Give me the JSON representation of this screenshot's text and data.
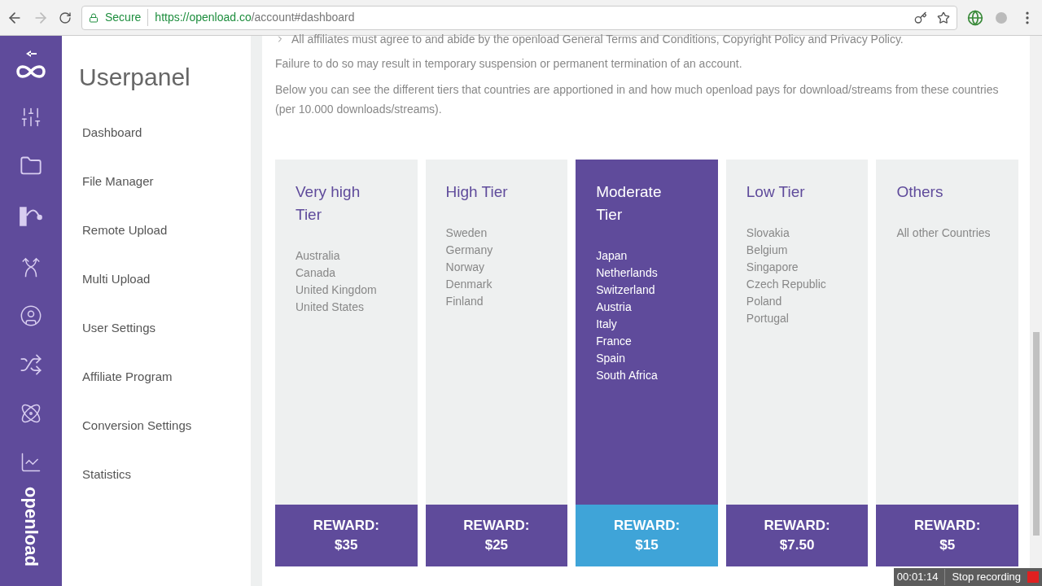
{
  "browser": {
    "secure_label": "Secure",
    "url_host": "https://openload.co",
    "url_path": "/account#dashboard"
  },
  "sidebar": {
    "title": "Userpanel",
    "items": [
      {
        "label": "Dashboard"
      },
      {
        "label": "File Manager"
      },
      {
        "label": "Remote Upload"
      },
      {
        "label": "Multi Upload"
      },
      {
        "label": "User Settings"
      },
      {
        "label": "Affiliate Program"
      },
      {
        "label": "Conversion Settings"
      },
      {
        "label": "Statistics"
      }
    ],
    "brand": "openload"
  },
  "content": {
    "rule": "All affiliates must agree to and abide by the openload General Terms and Conditions, Copyright Policy and Privacy Policy.",
    "paragraphs": [
      "Failure to do so may result in temporary suspension or permanent termination of an account.",
      "Below you can see the different tiers that countries are apportioned in and how much openload pays for download/streams from these countries (per 10.000 downloads/streams)."
    ]
  },
  "tiers": [
    {
      "title": "Very high Tier",
      "countries": [
        "Australia",
        "Canada",
        "United Kingdom",
        "United States"
      ],
      "reward_label": "REWARD:",
      "reward": "$35",
      "selected": false
    },
    {
      "title": "High Tier",
      "countries": [
        "Sweden",
        "Germany",
        "Norway",
        "Denmark",
        "Finland"
      ],
      "reward_label": "REWARD:",
      "reward": "$25",
      "selected": false
    },
    {
      "title": "Moderate Tier",
      "countries": [
        "Japan",
        "Netherlands",
        "Switzerland",
        "Austria",
        "Italy",
        "France",
        "Spain",
        "South Africa"
      ],
      "reward_label": "REWARD:",
      "reward": "$15",
      "selected": true
    },
    {
      "title": "Low Tier",
      "countries": [
        "Slovakia",
        "Belgium",
        "Singapore",
        "Czech Republic",
        "Poland",
        "Portugal"
      ],
      "reward_label": "REWARD:",
      "reward": "$7.50",
      "selected": false
    },
    {
      "title": "Others",
      "countries": [
        "All other Countries"
      ],
      "reward_label": "REWARD:",
      "reward": "$5",
      "selected": false
    }
  ],
  "recorder": {
    "time": "00:01:14",
    "action": "Stop recording"
  }
}
